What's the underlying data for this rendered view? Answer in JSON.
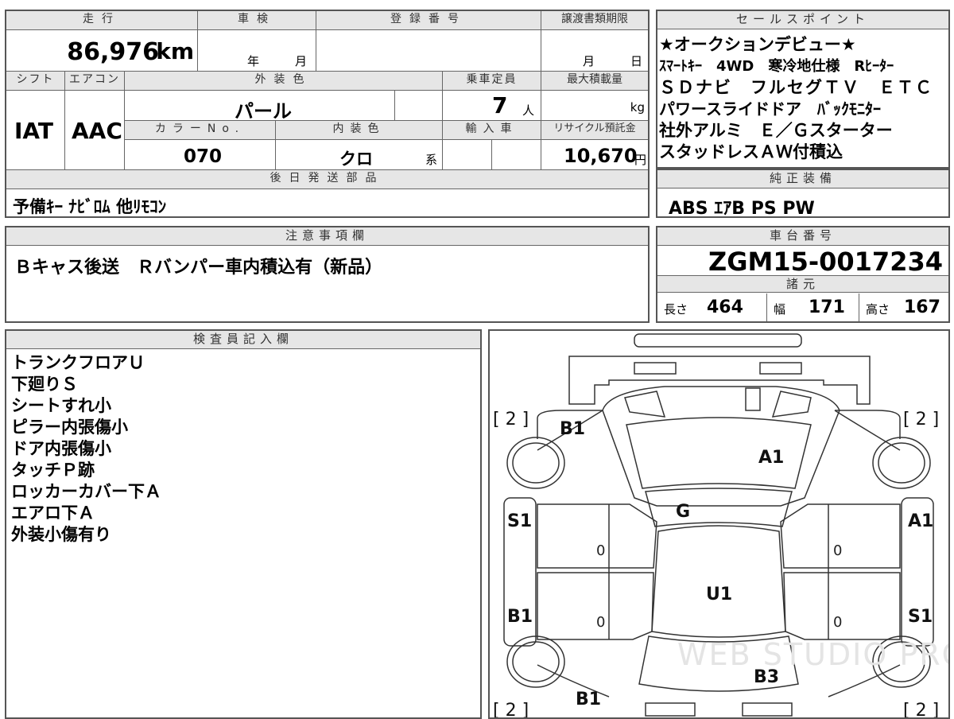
{
  "top": {
    "mileage_label": "走行",
    "mileage_value": "86,976",
    "mileage_unit": "km",
    "inspection_label": "車検",
    "inspection_year": "年",
    "inspection_month": "月",
    "registration_label": "登録番号",
    "transfer_label": "譲渡書類期限",
    "transfer_month": "月",
    "transfer_day": "日",
    "shift_label": "シフト",
    "ac_label": "エアコン",
    "color_label": "外装色",
    "capacity_label": "乗車定員",
    "maxload_label": "最大積載量",
    "shift_value": "IAT",
    "ac_value": "AAC",
    "color_value": "パール",
    "capacity_value": "7",
    "capacity_unit": "人",
    "maxload_unit": "kg",
    "color_no_label": "カラーNo.",
    "interior_label": "内装色",
    "import_label": "輸入車",
    "recycle_label": "リサイクル預託金",
    "color_no_value": "070",
    "interior_value": "クロ",
    "interior_suffix": "系",
    "recycle_value": "10,670",
    "recycle_unit": "円",
    "later_parts_label": "後日発送部品",
    "later_parts_value": "予備ｷｰ ﾅﾋﾞﾛﾑ 他ﾘﾓｺﾝ"
  },
  "sales": {
    "label": "セールスポイント",
    "lines": [
      "★オークションデビュー★",
      "ｽﾏｰﾄｷｰ　4WD　寒冷地仕様　Rﾋｰﾀｰ",
      "ＳＤナビ　フルセグＴＶ　ＥＴＣ",
      "パワースライドドア　ﾊﾞｯｸﾓﾆﾀｰ",
      "社外アルミ　Ｅ／Ｇスターター",
      "スタッドレスＡＷ付積込"
    ]
  },
  "equipment": {
    "label": "純正装備",
    "value": "ABS ｴｱB PS PW"
  },
  "notes": {
    "label": "注意事項欄",
    "value": "Ｂキャス後送　Ｒバンパー車内積込有（新品）"
  },
  "chassis": {
    "label": "車台番号",
    "value": "ZGM15-0017234"
  },
  "specs": {
    "label": "諸元",
    "length_label": "長さ",
    "length_value": "464",
    "width_label": "幅",
    "width_value": "171",
    "height_label": "高さ",
    "height_value": "167"
  },
  "inspector": {
    "label": "検査員記入欄",
    "lines": [
      "トランクフロアＵ",
      "下廻りＳ",
      "シートすれ小",
      "ピラー内張傷小",
      "ドア内張傷小",
      "タッチＰ跡",
      "ロッカーカバー下Ａ",
      "エアロ下Ａ",
      "外装小傷有り"
    ]
  },
  "diagram": {
    "tires": [
      "[ 2 ]",
      "[ 2 ]",
      "[ 2 ]",
      "[ 2 ]"
    ],
    "marks": [
      "B1",
      "A1",
      "G",
      "S1",
      "A1",
      "U1",
      "B1",
      "S1",
      "B3",
      "B1"
    ],
    "door_zero": [
      "0",
      "0",
      "0",
      "0"
    ],
    "watermark": "WEB STUDIO PRO"
  }
}
